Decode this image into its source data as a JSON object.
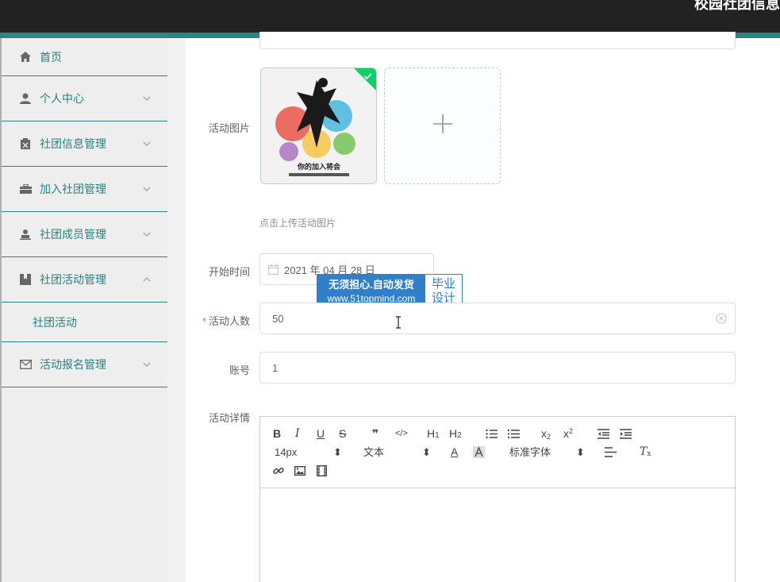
{
  "header": {
    "title": "校园社团信息"
  },
  "sidebar": {
    "items": [
      {
        "label": "首页",
        "icon": "home-icon"
      },
      {
        "label": "个人中心",
        "icon": "user-icon"
      },
      {
        "label": "社团信息管理",
        "icon": "clipboard-icon"
      },
      {
        "label": "加入社团管理",
        "icon": "briefcase-icon"
      },
      {
        "label": "社团成员管理",
        "icon": "person-icon"
      },
      {
        "label": "社团活动管理",
        "icon": "bookmark-icon"
      },
      {
        "label": "活动报名管理",
        "icon": "mail-icon"
      }
    ],
    "sub_item": "社团活动"
  },
  "form": {
    "image_label": "活动图片",
    "upload_hint": "点击上传活动图片",
    "start_time_label": "开始时间",
    "start_time_value": "2021 年 04 月 28 日",
    "count_label": "活动人数",
    "count_value": "50",
    "account_label": "账号",
    "account_value": "1",
    "detail_label": "活动详情",
    "thumb_caption": "你的加入将会"
  },
  "editor": {
    "font_size": "14px",
    "text_type": "文本",
    "font_family": "标准字体"
  },
  "watermark": {
    "line1": "无须担心.自动发货",
    "line2": "www.51topmind.com",
    "right1": "毕业",
    "right2": "设计"
  },
  "colors": {
    "accent": "#2a8585",
    "topbar": "#222222",
    "required": "#f56c6c",
    "success": "#13ce66",
    "watermark": "#2f7fc9"
  }
}
